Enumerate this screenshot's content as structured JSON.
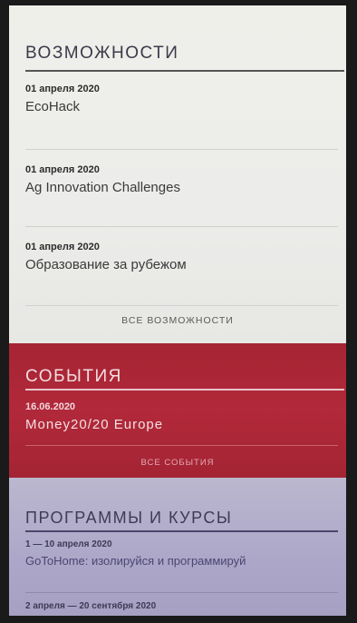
{
  "opportunities": {
    "title": "ВОЗМОЖНОСТИ",
    "items": [
      {
        "date": "01 апреля 2020",
        "title": "EcoHack"
      },
      {
        "date": "01 апреля 2020",
        "title": "Ag Innovation Challenges"
      },
      {
        "date": "01 апреля 2020",
        "title": "Образование за рубежом"
      }
    ],
    "all_link": "ВСЕ ВОЗМОЖНОСТИ"
  },
  "events": {
    "title": "СОБЫТИЯ",
    "items": [
      {
        "date": "16.06.2020",
        "title": "Money20/20 Europe"
      }
    ],
    "all_link": "ВСЕ СОБЫТИЯ"
  },
  "programs": {
    "title": "ПРОГРАММЫ И КУРСЫ",
    "items": [
      {
        "date": "1 — 10 апреля 2020",
        "title": "GoToHome: изолируйся и программируй"
      },
      {
        "date": "2 апреля — 20 сентября 2020",
        "title": ""
      }
    ]
  },
  "colors": {
    "events_bg": "#ad2738",
    "programs_bg": "#aca7c8",
    "opportunities_bg": "#eeeee9"
  }
}
